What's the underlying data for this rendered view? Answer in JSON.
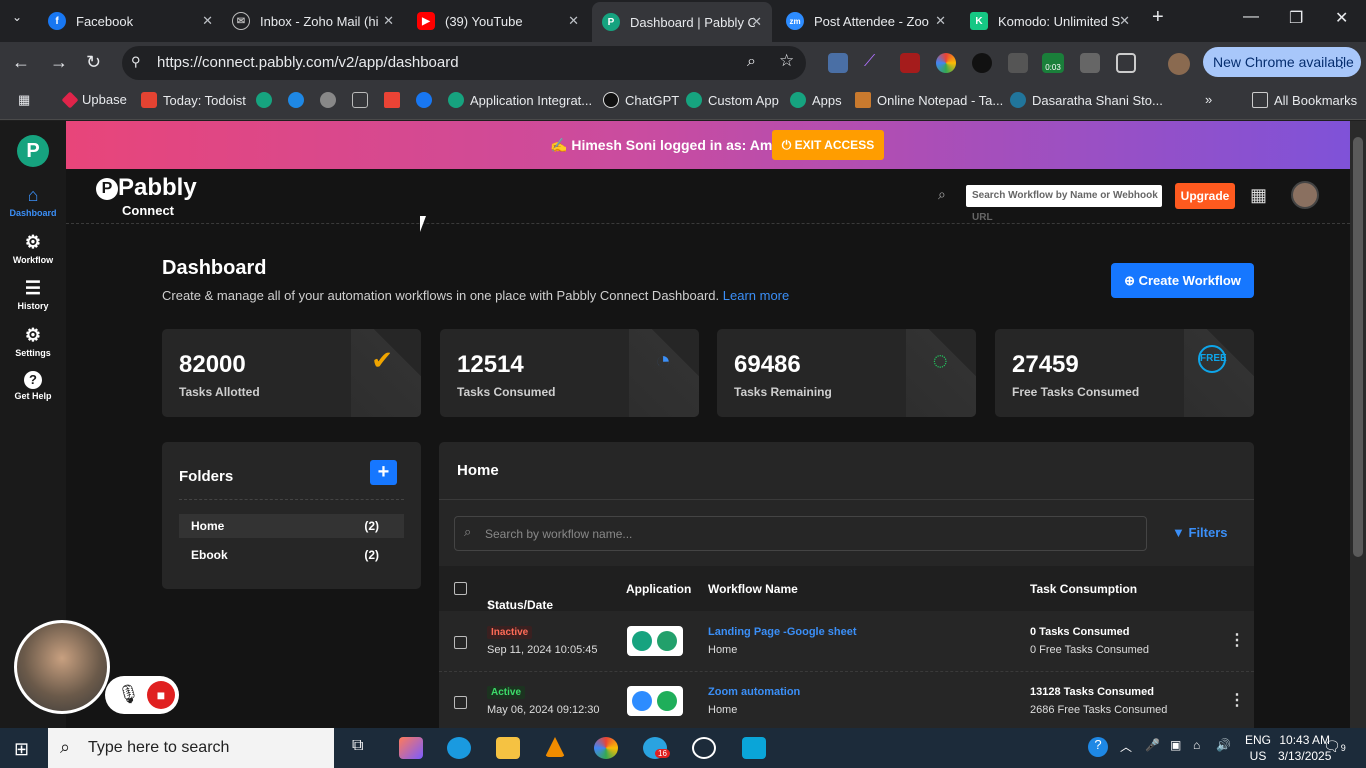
{
  "browser": {
    "tabs": [
      {
        "title": "Facebook",
        "color": "#1877f2",
        "glyph": "f"
      },
      {
        "title": "Inbox - Zoho Mail (hi",
        "color": "#888888",
        "glyph": "✉"
      },
      {
        "title": "(39) YouTube",
        "color": "#ff0000",
        "glyph": "▶"
      },
      {
        "title": "Dashboard | Pabbly C",
        "color": "#16a37f",
        "glyph": "P"
      },
      {
        "title": "Post Attendee - Zoo",
        "color": "#2d8cff",
        "glyph": "zm"
      },
      {
        "title": "Komodo: Unlimited S",
        "color": "#16c784",
        "glyph": "K"
      }
    ],
    "url": "https://connect.pabbly.com/v2/app/dashboard",
    "new_chrome": "New Chrome available",
    "bookmarks": [
      "Upbase",
      "Today: Todoist",
      "Application Integrat...",
      "ChatGPT",
      "Custom App",
      "Apps",
      "Online Notepad - Ta...",
      "Dasaratha Shani Sto..."
    ],
    "all_bookmarks": "All Bookmarks",
    "ext_badge": "0:03"
  },
  "sidebar": {
    "items": [
      {
        "label": "Dashboard",
        "icon": "home-icon",
        "glyph": "⌂"
      },
      {
        "label": "Workflow",
        "icon": "workflow-icon",
        "glyph": "⚙"
      },
      {
        "label": "History",
        "icon": "history-icon",
        "glyph": "☰"
      },
      {
        "label": "Settings",
        "icon": "settings-icon",
        "glyph": "⚙"
      },
      {
        "label": "Get Help",
        "icon": "help-icon",
        "glyph": "?"
      }
    ]
  },
  "banner": {
    "text": "Himesh Soni logged in as: Aman Doda",
    "exit": "EXIT ACCESS"
  },
  "header": {
    "brand": "Pabbly",
    "brand_sub": "Connect",
    "search_placeholder": "Search Workflow by Name or Webhook URL",
    "upgrade": "Upgrade"
  },
  "dashboard": {
    "title": "Dashboard",
    "subtitle": "Create & manage all of your automation workflows in one place with Pabbly Connect Dashboard.",
    "learn_more": "Learn more",
    "create": "Create Workflow"
  },
  "stats": [
    {
      "value": "82000",
      "label": "Tasks Allotted",
      "color": "#f0a500",
      "glyph": "✔"
    },
    {
      "value": "12514",
      "label": "Tasks Consumed",
      "color": "#3b8ff7",
      "glyph": "◔"
    },
    {
      "value": "69486",
      "label": "Tasks Remaining",
      "color": "#22c55e",
      "glyph": "◌"
    },
    {
      "value": "27459",
      "label": "Free Tasks Consumed",
      "color": "#0ea5e9",
      "glyph": "FREE"
    }
  ],
  "folders": {
    "title": "Folders",
    "items": [
      {
        "name": "Home",
        "count": "(2)"
      },
      {
        "name": "Ebook",
        "count": "(2)"
      }
    ]
  },
  "workflows": {
    "title": "Home",
    "search_placeholder": "Search by workflow name...",
    "filters": "Filters",
    "columns": [
      "Status/Date",
      "Application",
      "Workflow Name",
      "Task Consumption"
    ],
    "rows": [
      {
        "status": "Inactive",
        "date": "Sep 11, 2024 10:05:45",
        "name": "Landing Page -Google sheet",
        "folder": "Home",
        "tasks": "0 Tasks Consumed",
        "free": "0 Free Tasks Consumed"
      },
      {
        "status": "Active",
        "date": "May 06, 2024 09:12:30",
        "name": "Zoom automation",
        "folder": "Home",
        "tasks": "13128 Tasks Consumed",
        "free": "2686 Free Tasks Consumed"
      }
    ]
  },
  "taskbar": {
    "search": "Type here to search",
    "lang1": "ENG",
    "lang2": "US",
    "time": "10:43 AM",
    "date": "3/13/2025",
    "notif": "9",
    "telegram_badge": "16"
  }
}
